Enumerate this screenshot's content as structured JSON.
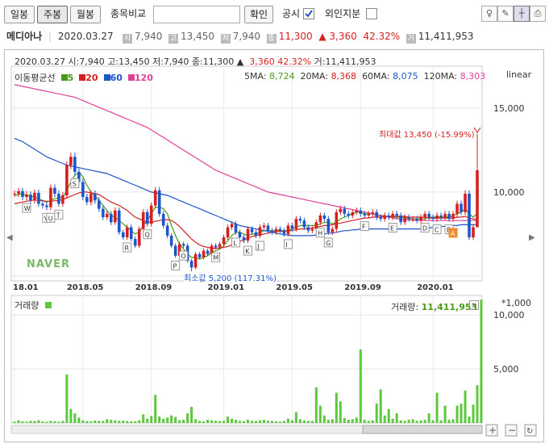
{
  "toolbar": {
    "periods": [
      "일봉",
      "주봉",
      "월봉"
    ],
    "active_period": "주봉",
    "compare_label": "종목비교",
    "compare_placeholder": "",
    "confirm_label": "확인",
    "disclosure_label": "공시",
    "foreign_label": "외인지분",
    "icons": [
      "light-icon",
      "pen-icon",
      "crosshair-icon",
      "print-icon"
    ]
  },
  "info": {
    "name": "메디아나",
    "date": "2020.03.27",
    "open_tag": "시",
    "open": "7,940",
    "high_tag": "고",
    "high": "13,450",
    "low_tag": "저",
    "low": "7,940",
    "close_tag": "종",
    "close": "11,300",
    "change": "▲ 3,360",
    "change_pct": "42.32%",
    "volume_tag": "거",
    "volume": "11,411,953"
  },
  "chart_header": {
    "line1_left": "2020.03.27  시:7,940  고:13,450  저:7,940 종:11,300 ▲",
    "line1_change": "3,360  42.32%",
    "line1_vol": "거:11,411,953",
    "ma_label": "이동평균선",
    "ma_periods": [
      "5",
      "20",
      "60",
      "120"
    ],
    "ma_values": [
      {
        "label": "5MA:",
        "value": "8,724"
      },
      {
        "label": "20MA:",
        "value": "8,368"
      },
      {
        "label": "60MA:",
        "value": "8,075"
      },
      {
        "label": "120MA:",
        "value": "8,303"
      }
    ],
    "scale": "linear",
    "watermark": "NAVER",
    "max_label": "최대값 13,450 (-15.99%)",
    "min_label": "최소값 5,200 (117.31%)",
    "volume_title": "거래량",
    "volume_readout_label": "거래량:",
    "volume_readout": "11,411,953",
    "volume_unit": "*1,000"
  },
  "colors": {
    "up": "#d62020",
    "down": "#1e55c8",
    "ma5": "#4a9a1a",
    "ma20": "#d62020",
    "ma60": "#1e55c8",
    "ma120": "#e0409a",
    "volume": "#5cc83c"
  },
  "chart_data": [
    {
      "type": "candlestick",
      "title": "메디아나 주봉",
      "x_ticks": [
        "18.01",
        "2018.05",
        "2018.09",
        "2019.01",
        "2019.05",
        "2019.09",
        "2020.01"
      ],
      "y_ticks": [
        5000,
        10000,
        15000
      ],
      "y_tick_labels": [
        "",
        "10,000",
        "15,000"
      ],
      "ylim": [
        4700,
        17500
      ],
      "scale": "linear",
      "max": 13450,
      "min": 5200,
      "close_series": [
        9900,
        10050,
        9700,
        9850,
        9500,
        9950,
        9300,
        9200,
        9100,
        10250,
        9900,
        9300,
        9800,
        11600,
        12100,
        11200,
        10600,
        9700,
        9400,
        9900,
        9500,
        9000,
        8500,
        8700,
        8200,
        8900,
        7600,
        7300,
        7900,
        7200,
        6800,
        7800,
        8800,
        8100,
        9200,
        10100,
        8700,
        8000,
        7400,
        6800,
        6200,
        6900,
        6800,
        5900,
        5500,
        6300,
        6100,
        6500,
        6300,
        6800,
        6700,
        6900,
        7300,
        7900,
        8100,
        7600,
        7300,
        7100,
        7800,
        7600,
        7400,
        7900,
        8000,
        7700,
        7600,
        7800,
        7700,
        7500,
        8000,
        7800,
        8400,
        8300,
        7900,
        7700,
        7800,
        8200,
        8600,
        8400,
        7600,
        7800,
        8800,
        9000,
        8700,
        8600,
        8800,
        8900,
        8700,
        8600,
        8700,
        8800,
        8500,
        8400,
        8600,
        8500,
        8700,
        8600,
        8200,
        8500,
        8400,
        8400,
        8300,
        8500,
        8700,
        8500,
        8400,
        8600,
        8500,
        8700,
        8400,
        8700,
        9300,
        8800,
        9900,
        7300,
        7900,
        11300
      ],
      "series": [
        {
          "name": "5",
          "values": [
            9800,
            9850,
            9900,
            9800,
            9750,
            9700,
            9600,
            9500,
            9400,
            9500,
            9600,
            9650,
            9700,
            10100,
            10600,
            11000,
            11200,
            10900,
            10400,
            10000,
            9800,
            9500,
            9200,
            8900,
            8600,
            8500,
            8300,
            8100,
            7900,
            7700,
            7500,
            7600,
            8000,
            8300,
            8700,
            9100,
            9100,
            9000,
            8700,
            8000,
            7400,
            6900,
            6600,
            6300,
            6100,
            6100,
            6000,
            6100,
            6200,
            6400,
            6500,
            6600,
            6800,
            7100,
            7400,
            7600,
            7600,
            7500,
            7400,
            7500,
            7500,
            7600,
            7700,
            7700,
            7700,
            7700,
            7700,
            7700,
            7700,
            7800,
            7900,
            8000,
            8000,
            8000,
            8000,
            8000,
            8100,
            8200,
            8200,
            8100,
            8200,
            8400,
            8500,
            8600,
            8700,
            8800,
            8800,
            8700,
            8700,
            8700,
            8600,
            8600,
            8600,
            8500,
            8500,
            8500,
            8500,
            8500,
            8400,
            8400,
            8400,
            8400,
            8400,
            8500,
            8500,
            8500,
            8500,
            8500,
            8500,
            8600,
            8700,
            8800,
            9000,
            8700,
            8500,
            8724
          ]
        },
        {
          "name": "20",
          "values": [
            9300,
            9350,
            9400,
            9450,
            9500,
            9520,
            9500,
            9480,
            9450,
            9450,
            9480,
            9500,
            9550,
            9650,
            9750,
            9850,
            9950,
            10000,
            10000,
            9950,
            9900,
            9850,
            9700,
            9550,
            9400,
            9300,
            9200,
            9050,
            8900,
            8700,
            8500,
            8400,
            8300,
            8200,
            8200,
            8250,
            8300,
            8350,
            8350,
            8300,
            8150,
            7950,
            7700,
            7450,
            7200,
            7000,
            6850,
            6750,
            6700,
            6650,
            6650,
            6650,
            6700,
            6750,
            6850,
            6950,
            7050,
            7150,
            7250,
            7350,
            7400,
            7450,
            7500,
            7550,
            7600,
            7650,
            7650,
            7650,
            7700,
            7700,
            7750,
            7800,
            7800,
            7850,
            7850,
            7900,
            7950,
            8000,
            8000,
            8050,
            8100,
            8150,
            8200,
            8250,
            8300,
            8350,
            8400,
            8450,
            8450,
            8500,
            8500,
            8500,
            8550,
            8550,
            8550,
            8550,
            8550,
            8550,
            8500,
            8500,
            8500,
            8500,
            8500,
            8450,
            8450,
            8450,
            8450,
            8450,
            8450,
            8450,
            8500,
            8500,
            8550,
            8450,
            8400,
            8368
          ]
        },
        {
          "name": "60",
          "values": [
            13200,
            13100,
            13000,
            12850,
            12700,
            12550,
            12400,
            12250,
            12100,
            12000,
            11900,
            11800,
            11700,
            11600,
            11550,
            11500,
            11450,
            11400,
            11350,
            11300,
            11250,
            11200,
            11150,
            11100,
            11000,
            10900,
            10800,
            10700,
            10600,
            10500,
            10400,
            10300,
            10200,
            10100,
            10000,
            9950,
            9900,
            9850,
            9800,
            9700,
            9600,
            9500,
            9400,
            9300,
            9200,
            9100,
            9000,
            8900,
            8800,
            8700,
            8600,
            8500,
            8400,
            8300,
            8200,
            8100,
            8000,
            7950,
            7900,
            7850,
            7800,
            7750,
            7700,
            7650,
            7600,
            7550,
            7500,
            7450,
            7450,
            7400,
            7400,
            7400,
            7400,
            7400,
            7400,
            7450,
            7450,
            7500,
            7550,
            7550,
            7600,
            7650,
            7700,
            7700,
            7750,
            7750,
            7800,
            7800,
            7800,
            7800,
            7800,
            7800,
            7800,
            7800,
            7800,
            7800,
            7800,
            7800,
            7800,
            7800,
            7800,
            7800,
            7850,
            7850,
            7900,
            7900,
            7950,
            7950,
            8000,
            8000,
            8000,
            8050,
            8050,
            8050,
            8050,
            8075
          ]
        },
        {
          "name": "120",
          "values": [
            16400,
            16350,
            16300,
            16250,
            16200,
            16150,
            16100,
            16050,
            16000,
            15950,
            15900,
            15850,
            15800,
            15750,
            15700,
            15650,
            15550,
            15450,
            15350,
            15250,
            15150,
            15050,
            14950,
            14850,
            14750,
            14650,
            14550,
            14450,
            14350,
            14250,
            14150,
            14050,
            13950,
            13850,
            13700,
            13550,
            13400,
            13250,
            13100,
            12950,
            12800,
            12650,
            12500,
            12350,
            12200,
            12050,
            11900,
            11750,
            11600,
            11450,
            11300,
            11200,
            11100,
            11000,
            10900,
            10800,
            10700,
            10600,
            10500,
            10400,
            10300,
            10200,
            10100,
            10000,
            9950,
            9900,
            9850,
            9800,
            9750,
            9700,
            9650,
            9600,
            9550,
            9500,
            9450,
            9400,
            9350,
            9300,
            9250,
            9200,
            9150,
            9100,
            9050,
            9000,
            8950,
            8900,
            8850,
            8800,
            8750,
            8700,
            8650,
            8600,
            8550,
            8500,
            8450,
            8400,
            8400,
            8350,
            8350,
            8300,
            8300,
            8300,
            8300,
            8300,
            8300,
            8300,
            8300,
            8300,
            8300,
            8300,
            8300,
            8300,
            8300,
            8300,
            8300,
            8303
          ]
        }
      ],
      "markers": [
        "W",
        "V",
        "U",
        "T",
        "S",
        "R",
        "Q",
        "P",
        "O",
        "N",
        "M",
        "L",
        "K",
        "J",
        "I",
        "H",
        "G",
        "F",
        "E",
        "D",
        "C",
        "B",
        "A"
      ]
    },
    {
      "type": "bar",
      "title": "거래량",
      "y_ticks": [
        5000,
        10000
      ],
      "y_tick_labels": [
        "5,000",
        "10,000"
      ],
      "ylim": [
        0,
        11800
      ],
      "unit": "*1,000",
      "values": [
        120,
        250,
        150,
        130,
        200,
        180,
        260,
        140,
        110,
        200,
        150,
        120,
        190,
        4500,
        1300,
        900,
        500,
        250,
        180,
        160,
        220,
        200,
        190,
        350,
        300,
        250,
        200,
        210,
        180,
        170,
        150,
        250,
        800,
        400,
        650,
        2600,
        600,
        400,
        500,
        700,
        550,
        250,
        300,
        900,
        1500,
        350,
        200,
        150,
        300,
        250,
        200,
        180,
        200,
        600,
        400,
        300,
        200,
        150,
        300,
        200,
        180,
        250,
        300,
        200,
        200,
        150,
        120,
        200,
        400,
        250,
        1000,
        350,
        250,
        200,
        200,
        3300,
        1600,
        700,
        300,
        350,
        2800,
        2000,
        450,
        300,
        350,
        500,
        6800,
        300,
        200,
        250,
        1800,
        3100,
        700,
        1300,
        400,
        900,
        250,
        200,
        300,
        350,
        200,
        250,
        300,
        900,
        250,
        2800,
        250,
        1600,
        300,
        350,
        1600,
        1800,
        3000,
        600,
        1700,
        3500,
        11412
      ]
    }
  ]
}
